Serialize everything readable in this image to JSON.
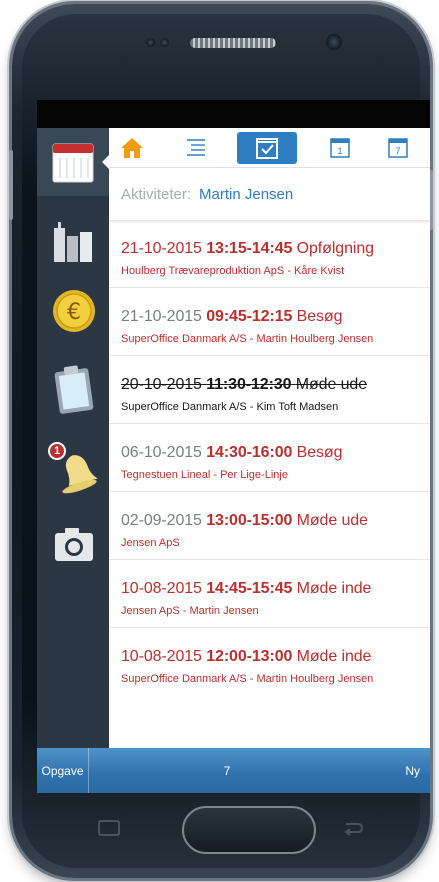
{
  "header": {
    "label": "Aktiviteter:",
    "person": "Martin Jensen"
  },
  "tabs": [
    {
      "icon": "home-icon"
    },
    {
      "icon": "list-icon"
    },
    {
      "icon": "checkbox-calendar-icon",
      "selected": true
    },
    {
      "icon": "calendar-day-1-icon",
      "text": "1"
    },
    {
      "icon": "calendar-week-7-icon",
      "text": "7"
    }
  ],
  "sidebar": {
    "items": [
      {
        "icon": "calendar-icon",
        "active": true
      },
      {
        "icon": "buildings-icon"
      },
      {
        "icon": "euro-coin-icon"
      },
      {
        "icon": "clipboard-icon"
      },
      {
        "icon": "bell-icon",
        "badge": "1"
      },
      {
        "icon": "camera-icon"
      }
    ]
  },
  "activities": [
    {
      "date": "21-10-2015",
      "time": "13:15-14:45",
      "title": "Opfølgning",
      "contact": "Houlberg Trævareproduktion ApS - Kåre Kvist"
    },
    {
      "date": "21-10-2015",
      "time": "09:45-12:15",
      "title": "Besøg",
      "contact": "SuperOffice Danmark A/S - Martin Houlberg Jensen"
    },
    {
      "date": "20-10-2015",
      "time": "11:30-12:30",
      "title": "Møde ude",
      "contact": "SuperOffice Danmark A/S - Kim Toft Madsen"
    },
    {
      "date": "06-10-2015",
      "time": "14:30-16:00",
      "title": "Besøg",
      "contact": "Tegnestuen Lineal - Per Lige-Linje"
    },
    {
      "date": "02-09-2015",
      "time": "13:00-15:00",
      "title": "Møde ude",
      "contact": "Jensen ApS"
    },
    {
      "date": "10-08-2015",
      "time": "14:45-15:45",
      "title": "Møde inde",
      "contact": "Jensen ApS - Martin Jensen"
    },
    {
      "date": "10-08-2015",
      "time": "12:00-13:00",
      "title": "Møde inde",
      "contact": "SuperOffice Danmark A/S - Martin Houlberg Jensen"
    }
  ],
  "bottom": {
    "left": "Opgave",
    "middle": "7",
    "right": "Ny"
  },
  "colors": {
    "accent": "#2f7ec1",
    "activity_red": "#b8312f",
    "sidebar": "#2b3844",
    "bottom_bar": "#2f71ad"
  }
}
